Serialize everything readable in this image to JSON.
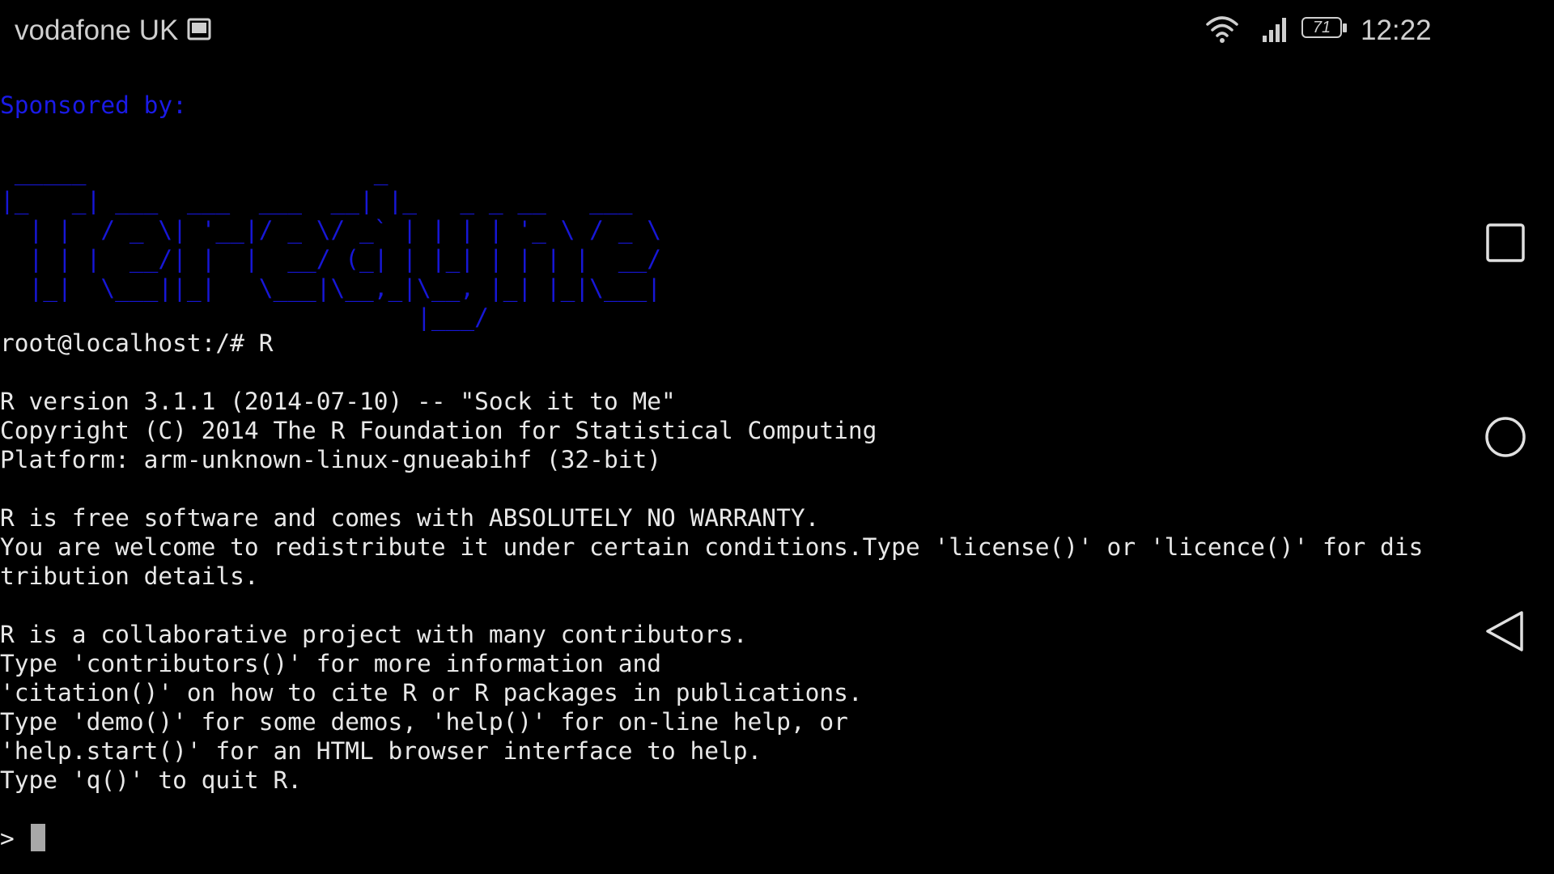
{
  "status_bar": {
    "carrier": "vodafone UK",
    "battery_level": "71",
    "time": "12:22",
    "icons": [
      "sim-card-icon",
      "wifi-icon",
      "cellular-signal-icon",
      "battery-icon"
    ]
  },
  "terminal": {
    "sponsor_label": "Sponsored by:",
    "logo_ascii": " _____                    _\n|_   _| ___  ___  ___  __| |_   _ _ __   ___\n  | |  / _ \\| '__|/ _ \\/ _` | | | | '_ \\ / _ \\\n  | | |  __/| |  |  __/ (_| | |_| | | | |  __/\n  |_|  \\___||_|   \\___|\\__,_|\\__, |_| |_|\\___|\n                             |___/",
    "lines": [
      "root@localhost:/# R",
      "R version 3.1.1 (2014-07-10) -- \"Sock it to Me\"",
      "Copyright (C) 2014 The R Foundation for Statistical Computing",
      "Platform: arm-unknown-linux-gnueabihf (32-bit)",
      "R is free software and comes with ABSOLUTELY NO WARRANTY.",
      "You are welcome to redistribute it under certain conditions.Type 'license()' or 'licence()' for dis",
      "tribution details.",
      "R is a collaborative project with many contributors.",
      "Type 'contributors()' for more information and",
      "'citation()' on how to cite R or R packages in publications.",
      "Type 'demo()' for some demos, 'help()' for on-line help, or",
      "'help.start()' for an HTML browser interface to help.",
      "Type 'q()' to quit R."
    ],
    "prompt": ">"
  },
  "nav_bar": {
    "buttons": [
      "recents-button",
      "home-button",
      "back-button"
    ]
  },
  "colors": {
    "background": "#000000",
    "terminal_text": "#e8e8e8",
    "sponsor_blue": "#1717d6",
    "status_text": "#cfcfcf"
  }
}
